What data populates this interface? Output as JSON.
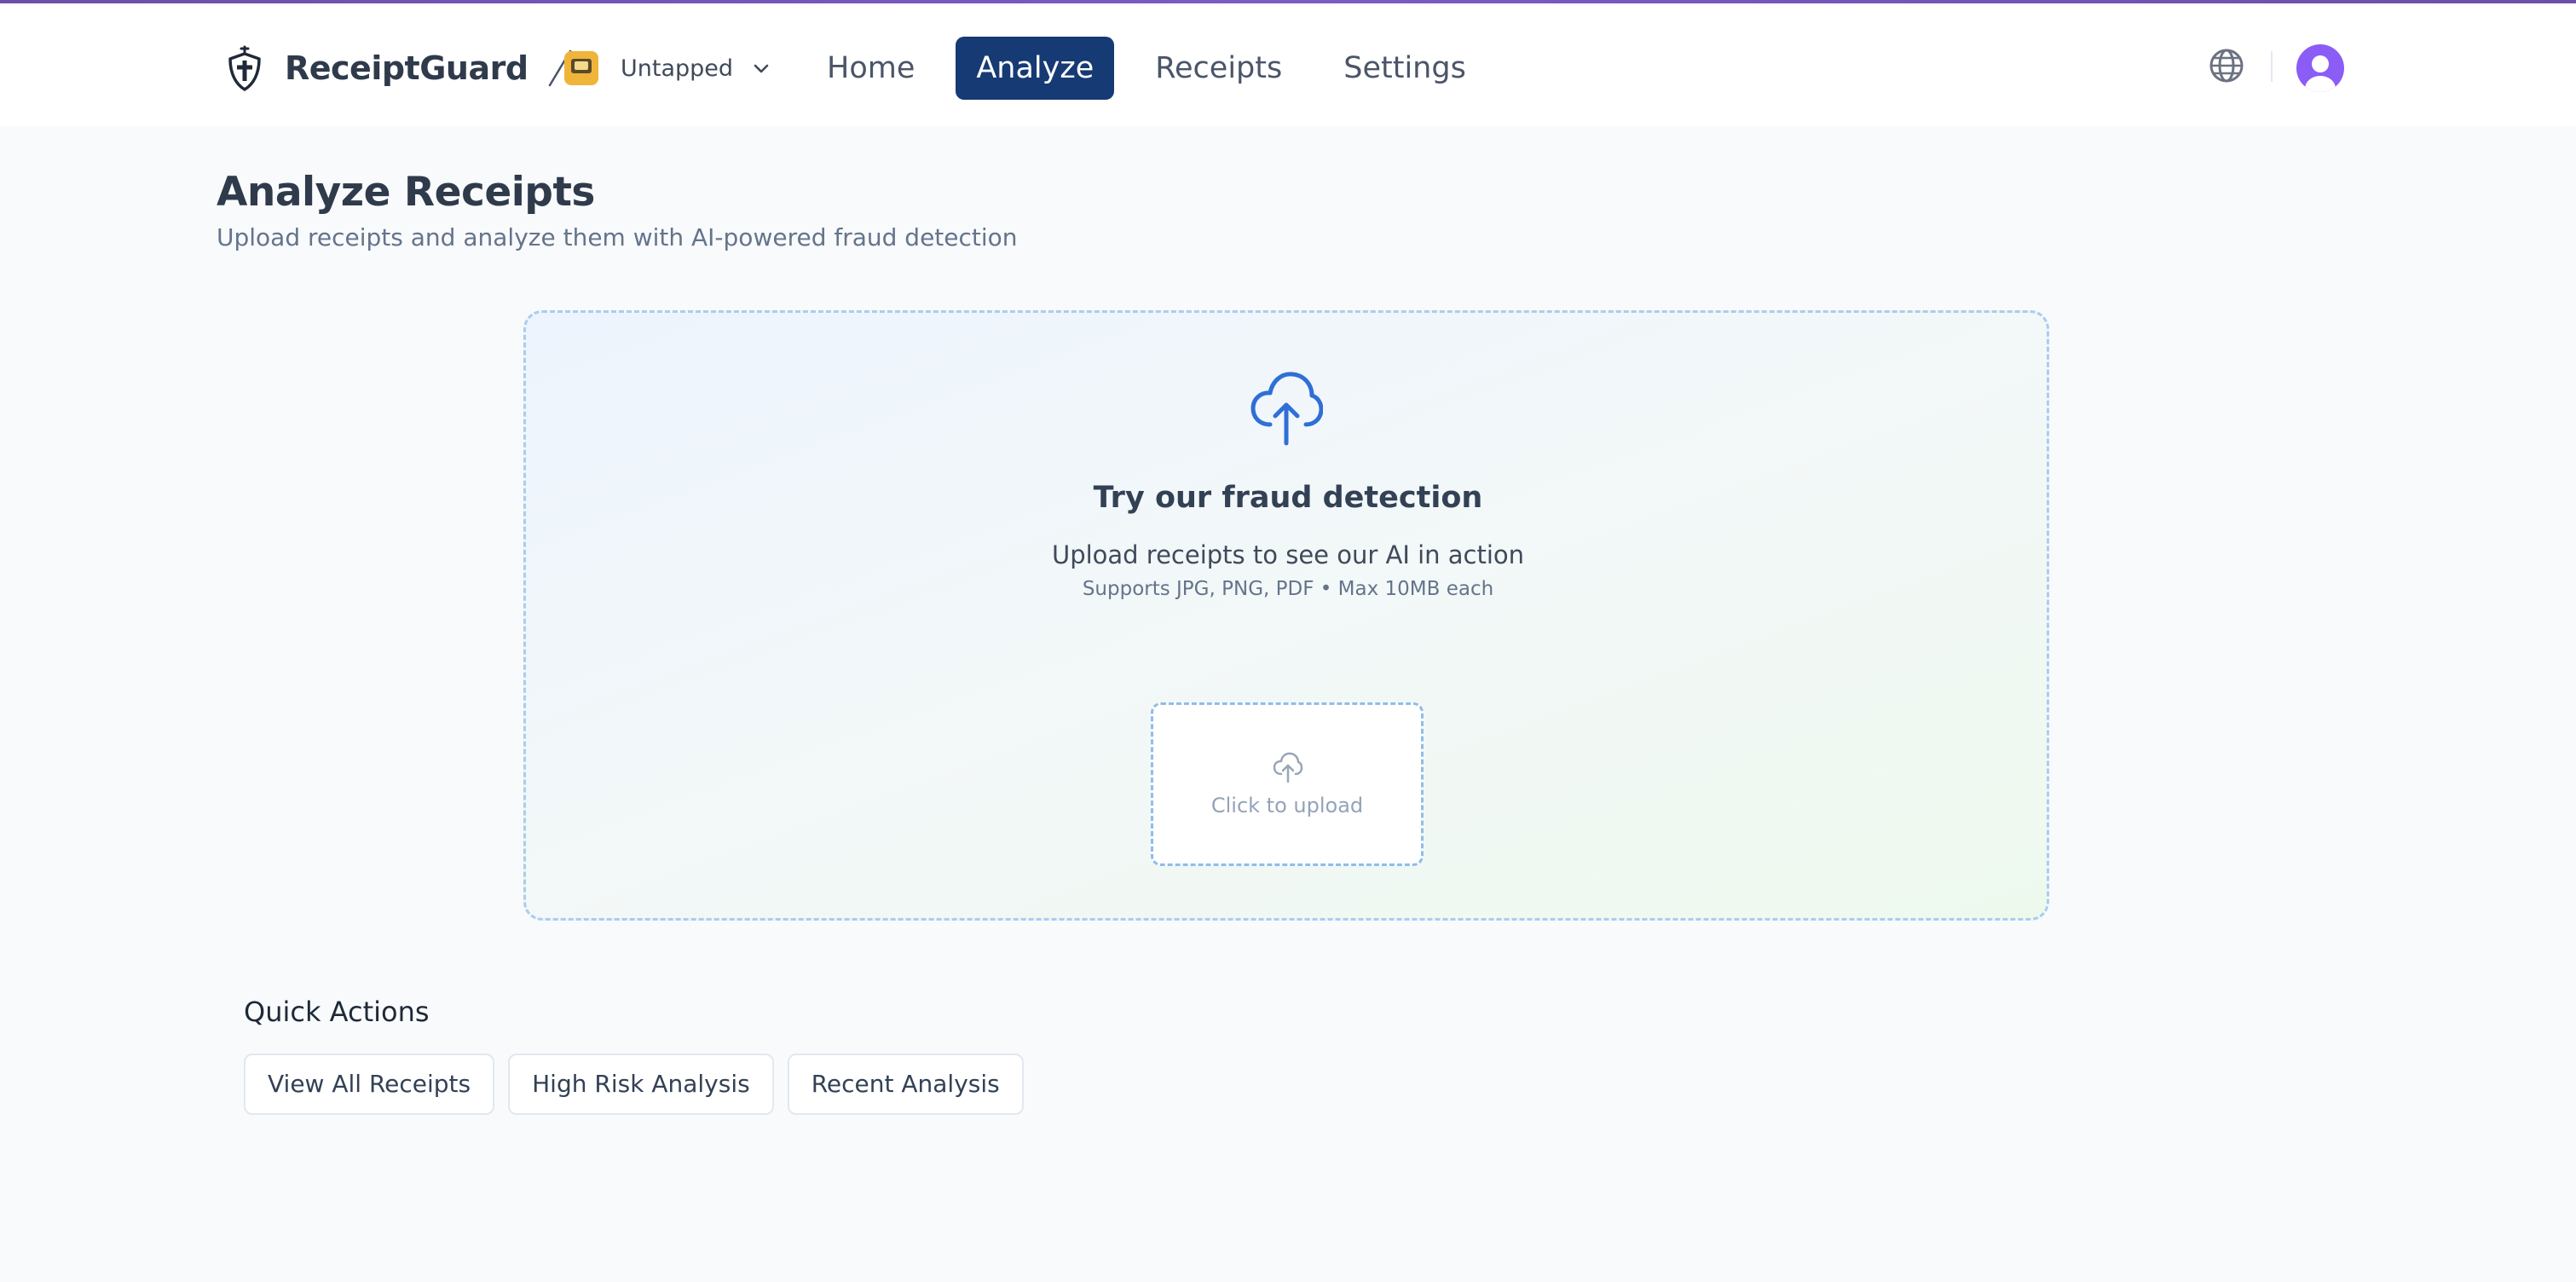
{
  "header": {
    "brand_name": "ReceiptGuard",
    "org_name": "Untapped",
    "nav": [
      {
        "label": "Home",
        "active": false
      },
      {
        "label": "Analyze",
        "active": true
      },
      {
        "label": "Receipts",
        "active": false
      },
      {
        "label": "Settings",
        "active": false
      }
    ],
    "icons": {
      "brand": "shield-icon",
      "org_switch": "chevron-down-icon",
      "language": "globe-icon",
      "profile": "user-avatar-icon"
    },
    "colors": {
      "accent_bar": "#7c5cc4",
      "nav_active_bg": "#163a73",
      "avatar_bg": "#8b5cf6"
    }
  },
  "page": {
    "title": "Analyze Receipts",
    "subtitle": "Upload receipts and analyze them with AI-powered fraud detection"
  },
  "dropzone": {
    "icon": "cloud-upload-icon",
    "title": "Try our fraud detection",
    "description": "Upload receipts to see our AI in action",
    "note": "Supports JPG, PNG, PDF • Max 10MB each",
    "upload_tile_label": "Click to upload",
    "colors": {
      "icon": "#2f6fd6",
      "border": "#a9cdf0"
    }
  },
  "quick_actions": {
    "title": "Quick Actions",
    "buttons": [
      "View All Receipts",
      "High Risk Analysis",
      "Recent Analysis"
    ]
  }
}
